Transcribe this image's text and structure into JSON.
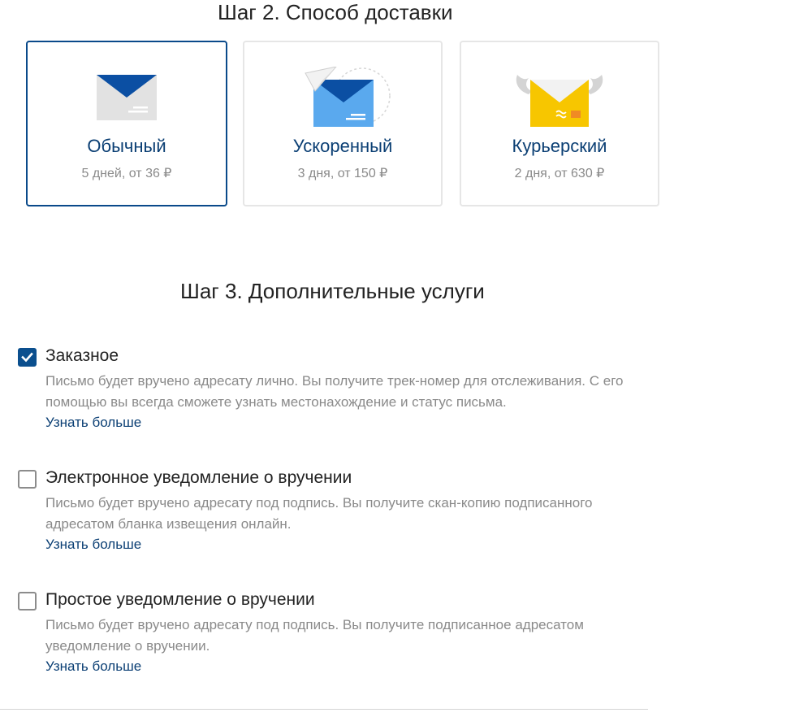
{
  "step2": {
    "title": "Шаг 2. Способ доставки"
  },
  "delivery_options": [
    {
      "name": "Обычный",
      "description": "5 дней, от 36 ₽",
      "icon": "envelope-icon",
      "selected": true
    },
    {
      "name": "Ускоренный",
      "description": "3 дня, от 150 ₽",
      "icon": "paper-plane-envelope-icon",
      "selected": false
    },
    {
      "name": "Курьерский",
      "description": "2 дня, от 630 ₽",
      "icon": "winged-envelope-icon",
      "selected": false
    }
  ],
  "step3": {
    "title": "Шаг 3. Дополнительные услуги"
  },
  "services": [
    {
      "title": "Заказное",
      "description": "Письмо будет вручено адресату лично. Вы получите трек-номер для отслеживания. С его помощью вы всегда сможете узнать местонахождение и статус письма.",
      "link": "Узнать больше",
      "checked": true
    },
    {
      "title": "Электронное уведомление о вручении",
      "description": "Письмо будет вручено адресату под подпись. Вы получите скан-копию подписанного адресатом бланка извещения онлайн.",
      "link": "Узнать больше",
      "checked": false
    },
    {
      "title": "Простое уведомление о вручении",
      "description": "Письмо будет вручено адресату под подпись. Вы получите подписанное адресатом уведомление о вручении.",
      "link": "Узнать больше",
      "checked": false
    }
  ],
  "colors": {
    "accent": "#0b4f8e",
    "link": "#0b3f74",
    "muted_text": "#8a8a8a",
    "envelope_yellow": "#f7c600",
    "envelope_blue": "#4aa3e8"
  }
}
